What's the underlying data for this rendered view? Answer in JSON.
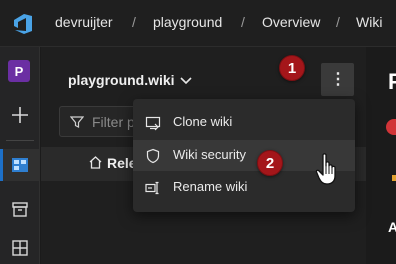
{
  "header": {
    "breadcrumbs": [
      "devruijter",
      "playground",
      "Overview",
      "Wiki"
    ],
    "separator": "/"
  },
  "rail": {
    "project_initial": "P",
    "icons": [
      "azure-devops-logo",
      "plus-icon",
      "boards-icon",
      "artifacts-icon",
      "test-plans-icon"
    ]
  },
  "wiki": {
    "title": "playground.wiki",
    "more_label": "⋮",
    "filter_placeholder": "Filter p",
    "tree_item": "Rele"
  },
  "menu": {
    "items": [
      {
        "label": "Clone wiki",
        "icon": "clone-icon"
      },
      {
        "label": "Wiki security",
        "icon": "shield-icon"
      },
      {
        "label": "Rename wiki",
        "icon": "rename-icon"
      }
    ],
    "highlighted_index": 1
  },
  "callouts": {
    "one": "1",
    "two": "2"
  },
  "right_panel": {
    "big": "P",
    "letter": "A"
  },
  "colors": {
    "accent": "#1d70c8",
    "badge": "#a4161a",
    "project": "#6b2fa3"
  }
}
